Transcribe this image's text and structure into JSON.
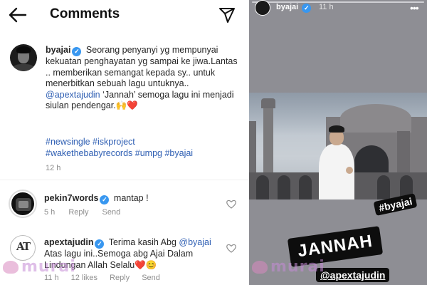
{
  "header": {
    "title": "Comments"
  },
  "post": {
    "username": "byajai",
    "caption": "Seorang penyanyi yg mempunyai kekuatan penghayatan yg sampai ke jiwa.Lantas .. memberikan semangat kepada sy.. untuk menerbitkan sebuah lagu untuknya..",
    "mention": "@apextajudin",
    "caption_tail": "‘Jannah’ semoga lagu ini menjadi siulan pendengar.",
    "caption_emoji": "🙌❤️",
    "hashtags_line1": "#newsingle #iskproject",
    "hashtags_line2": "#wakethebabyrecords #umpg #byajai",
    "time": "12 h"
  },
  "comments": [
    {
      "username": "pekin7words",
      "text": "mantap !",
      "time": "5 h",
      "reply": "Reply",
      "send": "Send"
    },
    {
      "username": "apextajudin",
      "text_head": "Terima kasih Abg",
      "mention": "@byajai",
      "text_tail": "Atas lagu ini..Semoga abg Ajai Dalam Lindungan Allah Selalu",
      "emoji": "❤️😊",
      "time": "11 h",
      "likes": "12 likes",
      "reply": "Reply",
      "send": "Send"
    }
  ],
  "watermark": {
    "text": "murai"
  },
  "story": {
    "username": "byajai",
    "time": "11 h",
    "menu": "•••",
    "tag_sticker": "#byajai",
    "title_sticker": "JANNAH",
    "mention_sticker": "@apextajudin"
  },
  "colors": {
    "link": "#2f5fb3",
    "verified": "#3897f0",
    "meta": "#8e8e8e",
    "story_bg": "#8e8e94"
  }
}
